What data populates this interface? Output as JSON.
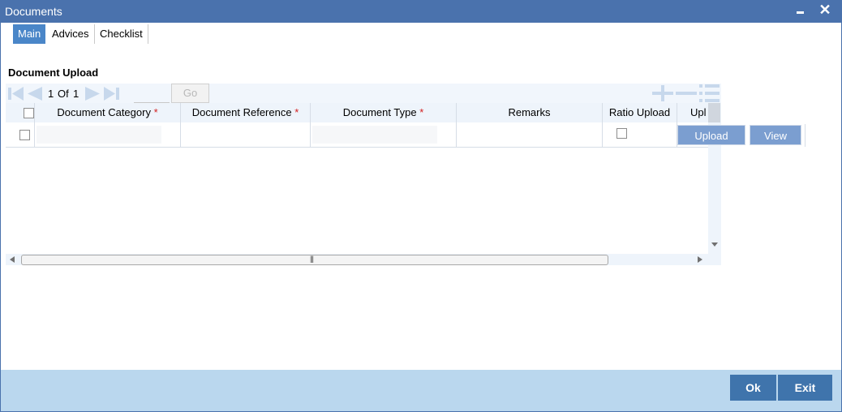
{
  "window": {
    "title": "Documents"
  },
  "tabs": [
    {
      "label": "Main",
      "active": true
    },
    {
      "label": "Advices",
      "active": false
    },
    {
      "label": "Checklist",
      "active": false
    }
  ],
  "section": {
    "title": "Document Upload"
  },
  "pager": {
    "current": "1",
    "of_label": "Of",
    "total": "1",
    "go_label": "Go"
  },
  "grid": {
    "columns": [
      {
        "label": "Document Category",
        "required": true
      },
      {
        "label": "Document Reference",
        "required": true
      },
      {
        "label": "Document Type",
        "required": true
      },
      {
        "label": "Remarks",
        "required": false
      },
      {
        "label": "Ratio Upload",
        "required": false
      },
      {
        "label": "Upl",
        "required": false
      }
    ],
    "required_mark": "*",
    "rows": [
      {
        "upload_label": "Upload",
        "view_label": "View"
      }
    ]
  },
  "footer": {
    "ok_label": "Ok",
    "exit_label": "Exit"
  },
  "colors": {
    "titlebar": "#4a72ad",
    "active_tab": "#4a86c8",
    "footer_bg": "#bad7ee",
    "footer_button": "#3f74ac",
    "row_button": "#7b9ed0",
    "required": "#d32020"
  },
  "icons": [
    "minimize-icon",
    "close-icon",
    "first-page-icon",
    "previous-page-icon",
    "next-page-icon",
    "last-page-icon",
    "add-row-icon",
    "delete-row-icon",
    "single-view-icon"
  ]
}
